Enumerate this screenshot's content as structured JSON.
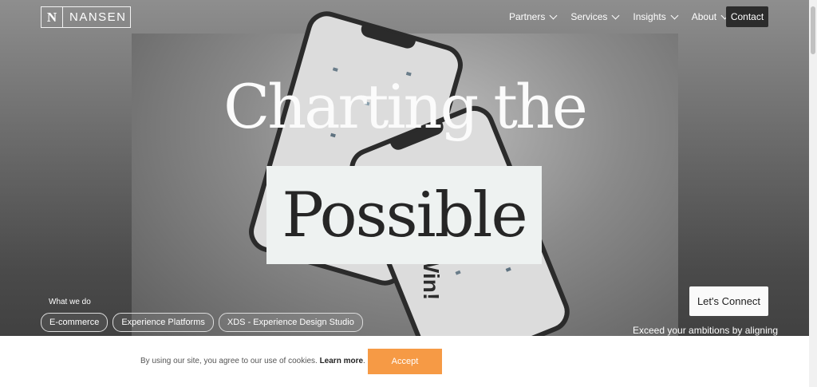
{
  "brand": {
    "mark": "N",
    "name": "NANSEN"
  },
  "nav": {
    "items": [
      {
        "label": "Partners"
      },
      {
        "label": "Services"
      },
      {
        "label": "Insights"
      },
      {
        "label": "About"
      }
    ],
    "contact_label": "Contact"
  },
  "hero": {
    "headline_line1": "Charting the",
    "headline_line2": "Possible",
    "what_we_do_label": "What we do",
    "chips": [
      "E-commerce",
      "Experience Platforms",
      "XDS - Experience Design Studio"
    ],
    "connect_label": "Let's Connect",
    "tagline": "Exceed your ambitions by aligning"
  },
  "cookie": {
    "text": "By using our site, you agree to our use of cookies.",
    "link": "Learn more",
    "accept_label": "Accept"
  },
  "colors": {
    "accept": "#f69a45",
    "contact_bg": "#2c2c2c",
    "headline_box": "#eef2f1"
  }
}
